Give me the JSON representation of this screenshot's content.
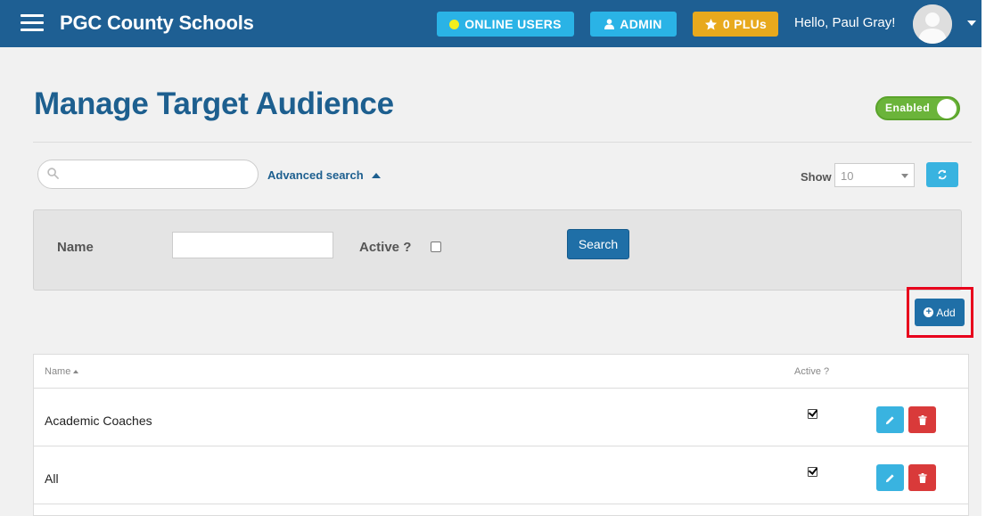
{
  "header": {
    "app_title": "PGC County Schools",
    "online_users_label": "ONLINE USERS",
    "admin_label": "ADMIN",
    "plus_label": "0 PLUs",
    "greeting": "Hello, ",
    "user_name": "Paul Gray!"
  },
  "page": {
    "title": "Manage Target Audience",
    "status_toggle_label": "Enabled"
  },
  "toolbar": {
    "search_placeholder": "",
    "advanced_search_label": "Advanced search",
    "show_label": "Show",
    "show_value": "10"
  },
  "advanced_search": {
    "name_label": "Name",
    "name_value": "",
    "active_label": "Active ?",
    "active_checked": false,
    "search_button_label": "Search"
  },
  "actions": {
    "add_button_label": "Add"
  },
  "table": {
    "columns": [
      "Name",
      "Active ?"
    ],
    "rows": [
      {
        "name": "Academic Coaches",
        "active": true
      },
      {
        "name": "All",
        "active": true
      }
    ]
  },
  "colors": {
    "navbar": "#1e5f93",
    "accent": "#39b3e0",
    "primary_button": "#1f6fa7",
    "danger": "#d93a3a",
    "plus_badge": "#e8a91d",
    "enabled_toggle": "#6bb43a",
    "highlight_box": "#e8001c"
  }
}
